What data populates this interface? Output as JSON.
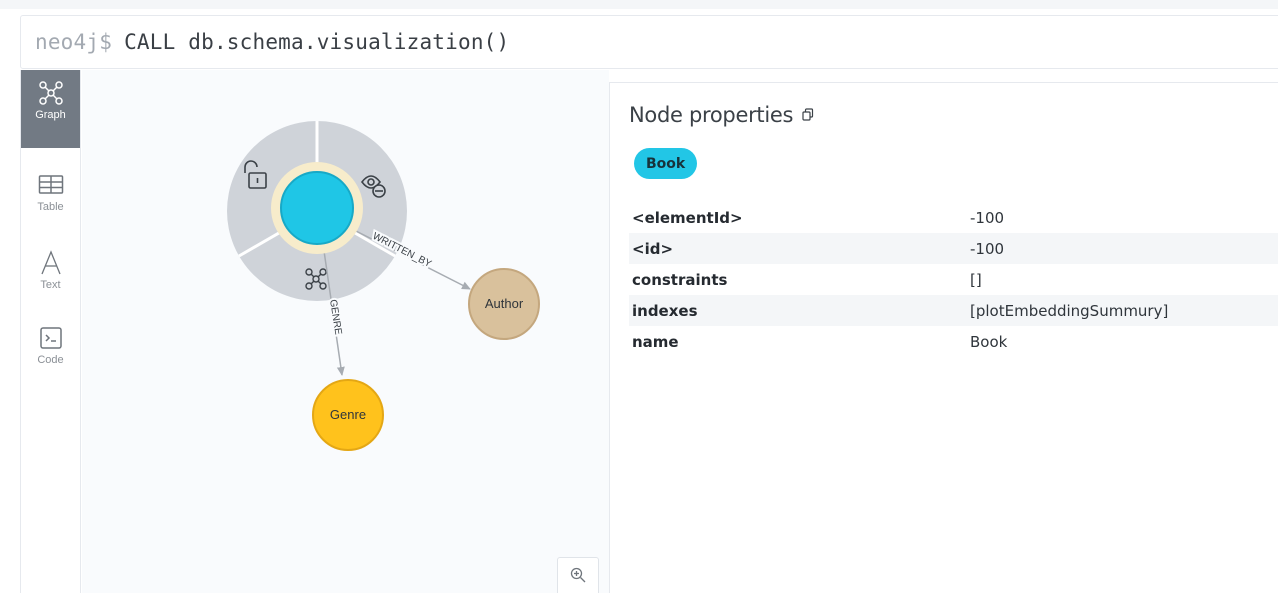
{
  "command": {
    "prompt": "neo4j$",
    "text": "CALL db.schema.visualization()"
  },
  "nav": {
    "items": [
      {
        "label": "Graph",
        "icon": "graph-icon",
        "active": true
      },
      {
        "label": "Table",
        "icon": "table-icon",
        "active": false
      },
      {
        "label": "Text",
        "icon": "text-icon",
        "active": false
      },
      {
        "label": "Code",
        "icon": "code-icon",
        "active": false
      }
    ]
  },
  "graph": {
    "nodes": [
      {
        "id": "book",
        "label": "",
        "color": "#1fc6e6",
        "border": "#17a9c7"
      },
      {
        "id": "author",
        "label": "Author",
        "color": "#d9c19c",
        "border": "#c4a77e"
      },
      {
        "id": "genre",
        "label": "Genre",
        "color": "#ffc21c",
        "border": "#e4a714"
      }
    ],
    "relationships": [
      {
        "label": "WRITTEN_BY",
        "from": "book",
        "to": "author"
      },
      {
        "label": "GENRE",
        "from": "book",
        "to": "genre"
      }
    ],
    "ring_actions": [
      "unlock-icon",
      "hide-icon",
      "expand-icon"
    ]
  },
  "panel": {
    "title": "Node properties",
    "label_chip": "Book",
    "properties": [
      {
        "key": "<elementId>",
        "value": "-100"
      },
      {
        "key": "<id>",
        "value": "-100"
      },
      {
        "key": "constraints",
        "value": "[]"
      },
      {
        "key": "indexes",
        "value": "[plotEmbeddingSummury]"
      },
      {
        "key": "name",
        "value": "Book"
      }
    ]
  },
  "colors": {
    "accent": "#1fc6e6",
    "nav_active": "#727a84",
    "ring": "#d0d4da",
    "halo": "#f7eccb"
  }
}
